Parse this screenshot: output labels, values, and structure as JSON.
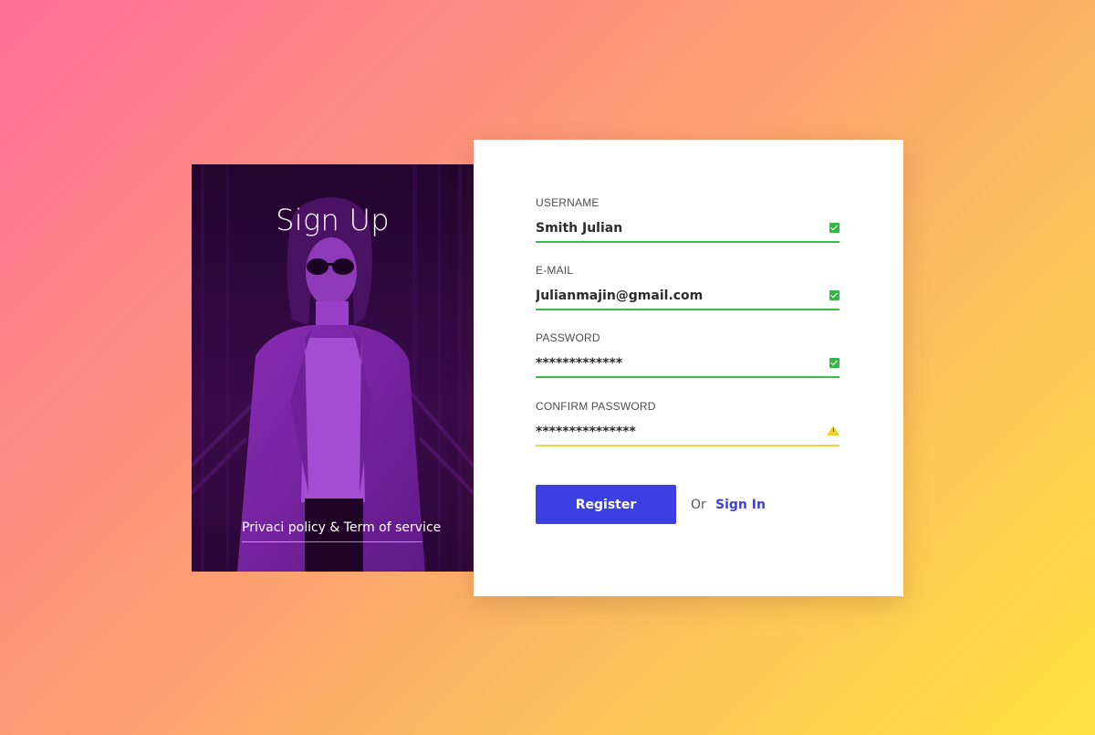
{
  "panel": {
    "title": "Sign Up",
    "policy_link": "Privaci policy & Term of service"
  },
  "form": {
    "fields": [
      {
        "label": "USERNAME",
        "value": "Smith Julian",
        "status": "valid"
      },
      {
        "label": "E-MAIL",
        "value": "Julianmajin@gmail.com",
        "status": "valid"
      },
      {
        "label": "PASSWORD",
        "value": "*************",
        "status": "valid"
      },
      {
        "label": "CONFIRM PASSWORD",
        "value": "***************",
        "status": "warning"
      }
    ],
    "register_label": "Register",
    "or_text": "Or",
    "signin_label": "Sign In"
  },
  "colors": {
    "accent": "#3b3fe4",
    "valid": "#35b544",
    "warning": "#e9cf2b",
    "panel_tint": "#7a1fa2"
  },
  "icons": {
    "valid": "check-square-icon",
    "warning": "warning-triangle-icon"
  }
}
